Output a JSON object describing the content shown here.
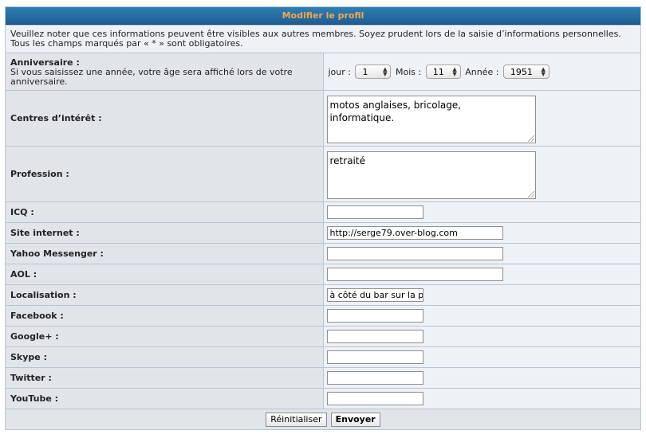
{
  "header": {
    "title": "Modifier le profil"
  },
  "notice": "Veuillez noter que ces informations peuvent être visibles aux autres membres. Soyez prudent lors de la saisie d’informations personnelles. Tous les champs marqués par « * » sont obligatoires.",
  "birthday": {
    "label": "Anniversaire :",
    "help": "Si vous saisissez une année, votre âge sera affiché lors de votre anniversaire.",
    "day_label": "jour :",
    "day_value": "1",
    "month_label": "Mois :",
    "month_value": "11",
    "year_label": "Année :",
    "year_value": "1951"
  },
  "interests": {
    "label": "Centres d’intérêt :",
    "value": "motos anglaises, bricolage,\ninformatique."
  },
  "occupation": {
    "label": "Profession :",
    "value": "retraité"
  },
  "fields": {
    "icq": {
      "label": "ICQ :",
      "value": ""
    },
    "website": {
      "label": "Site internet :",
      "value": "http://serge79.over-blog.com"
    },
    "yahoo": {
      "label": "Yahoo Messenger :",
      "value": ""
    },
    "aol": {
      "label": "AOL :",
      "value": ""
    },
    "location": {
      "label": "Localisation :",
      "value": "à côté du bar sur la pl"
    },
    "facebook": {
      "label": "Facebook :",
      "value": ""
    },
    "google": {
      "label": "Google+ :",
      "value": ""
    },
    "skype": {
      "label": "Skype :",
      "value": ""
    },
    "twitter": {
      "label": "Twitter :",
      "value": ""
    },
    "youtube": {
      "label": "YouTube :",
      "value": ""
    }
  },
  "buttons": {
    "reset": "Réinitialiser",
    "submit": "Envoyer"
  }
}
